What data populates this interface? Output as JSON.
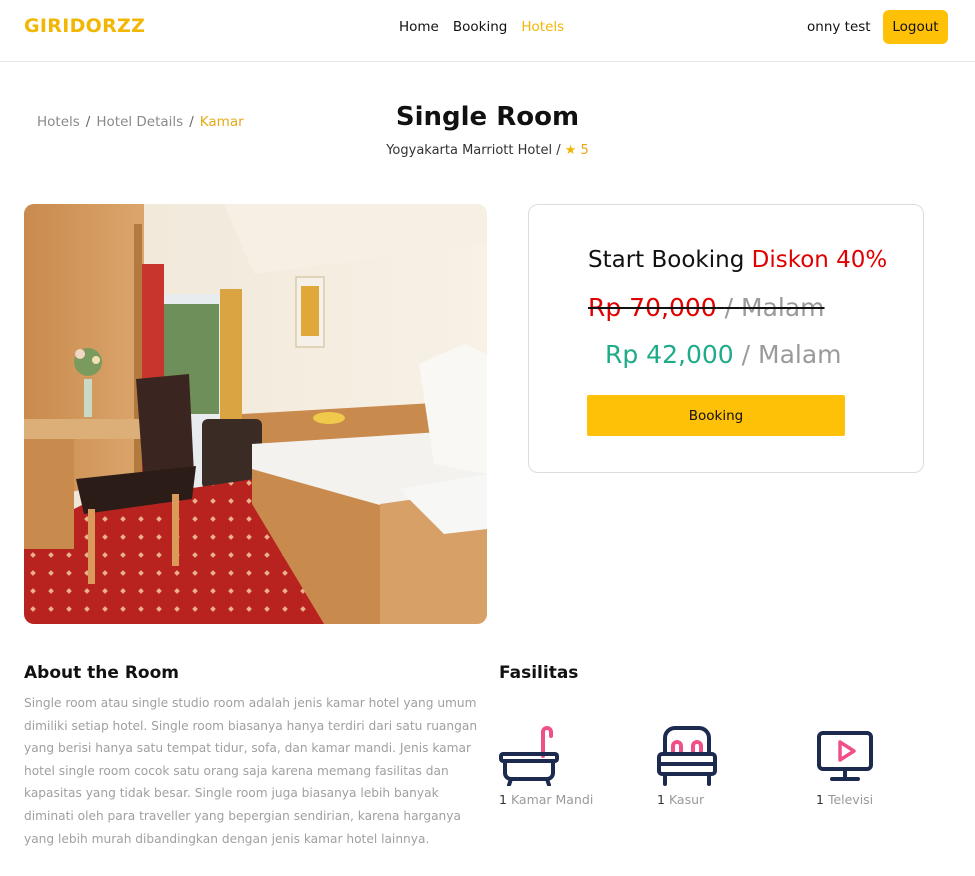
{
  "navbar": {
    "brand": "GIRIDORZZ",
    "links": [
      {
        "label": "Home"
      },
      {
        "label": "Booking"
      },
      {
        "label": "Hotels"
      }
    ],
    "user_name": "onny test",
    "logout_label": "Logout"
  },
  "breadcrumb": {
    "items": [
      "Hotels",
      "Hotel Details",
      "Kamar"
    ],
    "separator": "/"
  },
  "room": {
    "title": "Single Room",
    "hotel_name": "Yogyakarta Marriott Hotel /",
    "rating": "5"
  },
  "booking": {
    "heading": "Start Booking",
    "discount": "Diskon 40%",
    "old_price": "Rp 70,000",
    "new_price": "Rp 42,000",
    "unit": "/ Malam",
    "button_label": "Booking"
  },
  "about": {
    "title": "About the Room",
    "text": "Single room atau single studio room adalah jenis kamar hotel yang umum dimiliki setiap hotel. Single room biasanya hanya terdiri dari satu ruangan yang berisi hanya satu tempat tidur, sofa, dan kamar mandi. Jenis kamar hotel single room cocok satu orang saja karena memang fasilitas dan kapasitas yang tidak besar. Single room juga biasanya lebih banyak diminati oleh para traveller yang bepergian sendirian, karena harganya yang lebih murah dibandingkan dengan jenis kamar hotel lainnya."
  },
  "facilities": {
    "title": "Fasilitas",
    "items": [
      {
        "count": "1",
        "label": "Kamar Mandi",
        "icon": "bathtub-icon"
      },
      {
        "count": "1",
        "label": "Kasur",
        "icon": "bed-icon"
      },
      {
        "count": "1",
        "label": "Televisi",
        "icon": "tv-icon"
      }
    ]
  },
  "colors": {
    "accent": "#ffc107",
    "brand": "#f2b705",
    "discount": "#e00000",
    "new_price": "#1fab89",
    "icon_navy": "#1b2a4e",
    "icon_pink": "#f0508a"
  }
}
